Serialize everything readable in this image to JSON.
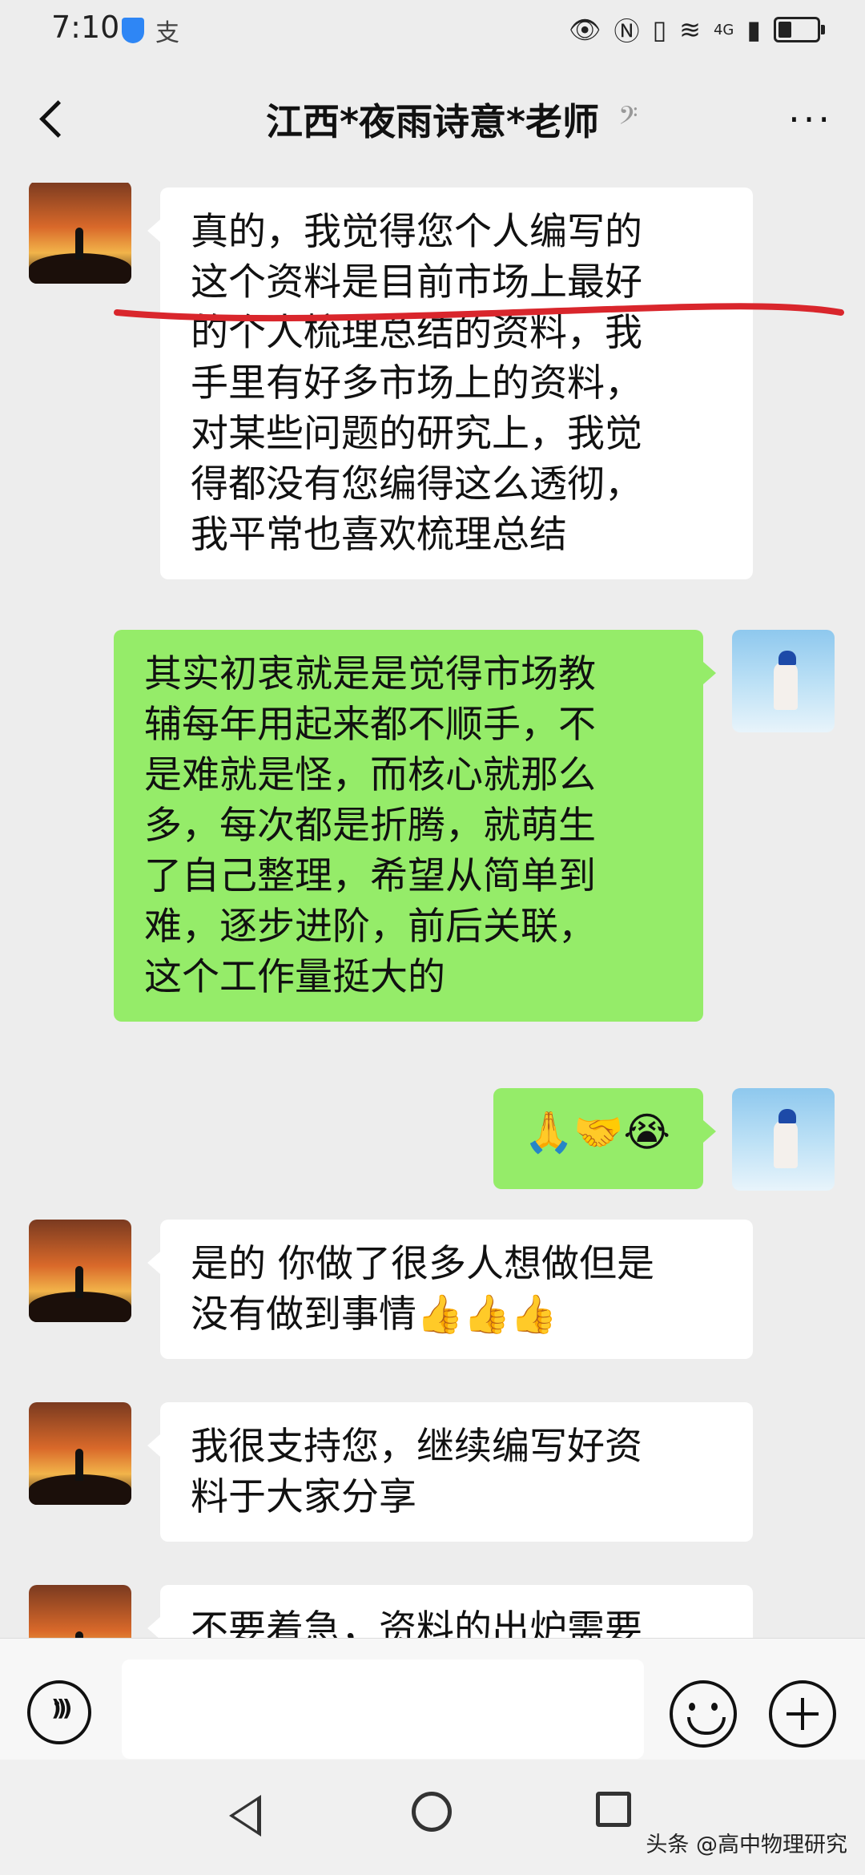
{
  "status": {
    "time": "7:10",
    "app_icon": "支",
    "right_icons": [
      "eye-icon",
      "nfc-icon",
      "vibrate-icon",
      "wifi-icon",
      "4g-signal-icon",
      "battery-icon"
    ],
    "network": "4G",
    "battery_level": 0.4
  },
  "header": {
    "title": "江西*夜雨诗意*老师",
    "ear_icon": "ear-icon",
    "more": "···"
  },
  "messages": [
    {
      "side": "left",
      "avatar": "sunset-silhouette",
      "lines": [
        "真的，我觉得您个人编写的",
        "这个资料是目前市场上最好",
        "的个人梳理总结的资料，我",
        "手里有好多市场上的资料，",
        "对某些问题的研究上，我觉",
        "得都没有您编得这么透彻，",
        "我平常也喜欢梳理总结"
      ]
    },
    {
      "side": "right",
      "avatar": "girl-blue-sky",
      "lines": [
        "其实初衷就是是觉得市场教",
        "辅每年用起来都不顺手，不",
        "是难就是怪，而核心就那么",
        "多，每次都是折腾，就萌生",
        "了自己整理，希望从简单到",
        "难，逐步进阶，前后关联，",
        "这个工作量挺大的"
      ]
    },
    {
      "side": "right",
      "avatar": "girl-blue-sky",
      "lines": [
        "🙏🤝😭"
      ]
    },
    {
      "side": "left",
      "avatar": "sunset-silhouette",
      "lines": [
        "是的  你做了很多人想做但是",
        "没有做到事情👍👍👍"
      ]
    },
    {
      "side": "left",
      "avatar": "sunset-silhouette",
      "lines": [
        "我很支持您，继续编写好资",
        "料于大家分享"
      ]
    },
    {
      "side": "left",
      "avatar": "sunset-silhouette",
      "lines": [
        "不要着急，资料的出炉需要"
      ]
    }
  ],
  "annotation": {
    "color": "#d9262c"
  },
  "input": {
    "placeholder": ""
  },
  "watermark": "头条 @高中物理研究"
}
